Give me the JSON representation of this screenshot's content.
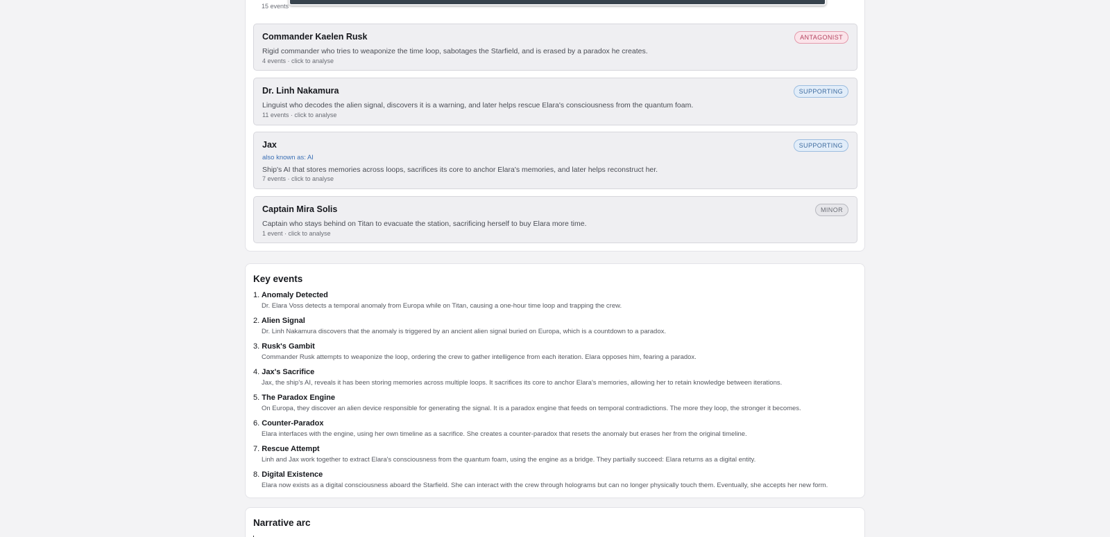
{
  "characters": {
    "partial_top_meta": "15 events",
    "cards": [
      {
        "name": "Commander Kaelen Rusk",
        "role": "ANTAGONIST",
        "description": "Rigid commander who tries to weaponize the time loop, sabotages the Starfield, and is erased by a paradox he creates.",
        "meta": "4 events · click to analyse"
      },
      {
        "name": "Dr. Linh Nakamura",
        "role": "SUPPORTING",
        "description": "Linguist who decodes the alien signal, discovers it is a warning, and later helps rescue Elara's consciousness from the quantum foam.",
        "meta": "11 events · click to analyse"
      },
      {
        "name": "Jax",
        "role": "SUPPORTING",
        "aka": "also known as: AI",
        "description": "Ship's AI that stores memories across loops, sacrifices its core to anchor Elara's memories, and later helps reconstruct her.",
        "meta": "7 events · click to analyse"
      },
      {
        "name": "Captain Mira Solis",
        "role": "MINOR",
        "description": "Captain who stays behind on Titan to evacuate the station, sacrificing herself to buy Elara more time.",
        "meta": "1 event · click to analyse"
      }
    ]
  },
  "key_events": {
    "title": "Key events",
    "items": [
      {
        "num": "1.",
        "title": "Anomaly Detected",
        "desc": "Dr. Elara Voss detects a temporal anomaly from Europa while on Titan, causing a one-hour time loop and trapping the crew."
      },
      {
        "num": "2.",
        "title": "Alien Signal",
        "desc": "Dr. Linh Nakamura discovers that the anomaly is triggered by an ancient alien signal buried on Europa, which is a countdown to a paradox."
      },
      {
        "num": "3.",
        "title": "Rusk's Gambit",
        "desc": "Commander Rusk attempts to weaponize the loop, ordering the crew to gather intelligence from each iteration. Elara opposes him, fearing a paradox."
      },
      {
        "num": "4.",
        "title": "Jax's Sacrifice",
        "desc": "Jax, the ship's AI, reveals it has been storing memories across multiple loops. It sacrifices its core to anchor Elara's memories, allowing her to retain knowledge between iterations."
      },
      {
        "num": "5.",
        "title": "The Paradox Engine",
        "desc": "On Europa, they discover an alien device responsible for generating the signal. It is a paradox engine that feeds on temporal contradictions. The more they loop, the stronger it becomes."
      },
      {
        "num": "6.",
        "title": "Counter-Paradox",
        "desc": "Elara interfaces with the engine, using her own timeline as a sacrifice. She creates a counter-paradox that resets the anomaly but erases her from the original timeline."
      },
      {
        "num": "7.",
        "title": "Rescue Attempt",
        "desc": "Linh and Jax work together to extract Elara's consciousness from the quantum foam, using the engine as a bridge. They partially succeed: Elara returns as a digital entity."
      },
      {
        "num": "8.",
        "title": "Digital Existence",
        "desc": "Elara now exists as a digital consciousness aboard the Starfield. She can interact with the crew through holograms but can no longer physically touch them. Eventually, she accepts her new form."
      }
    ]
  },
  "narrative_arc": {
    "title": "Narrative arc"
  }
}
